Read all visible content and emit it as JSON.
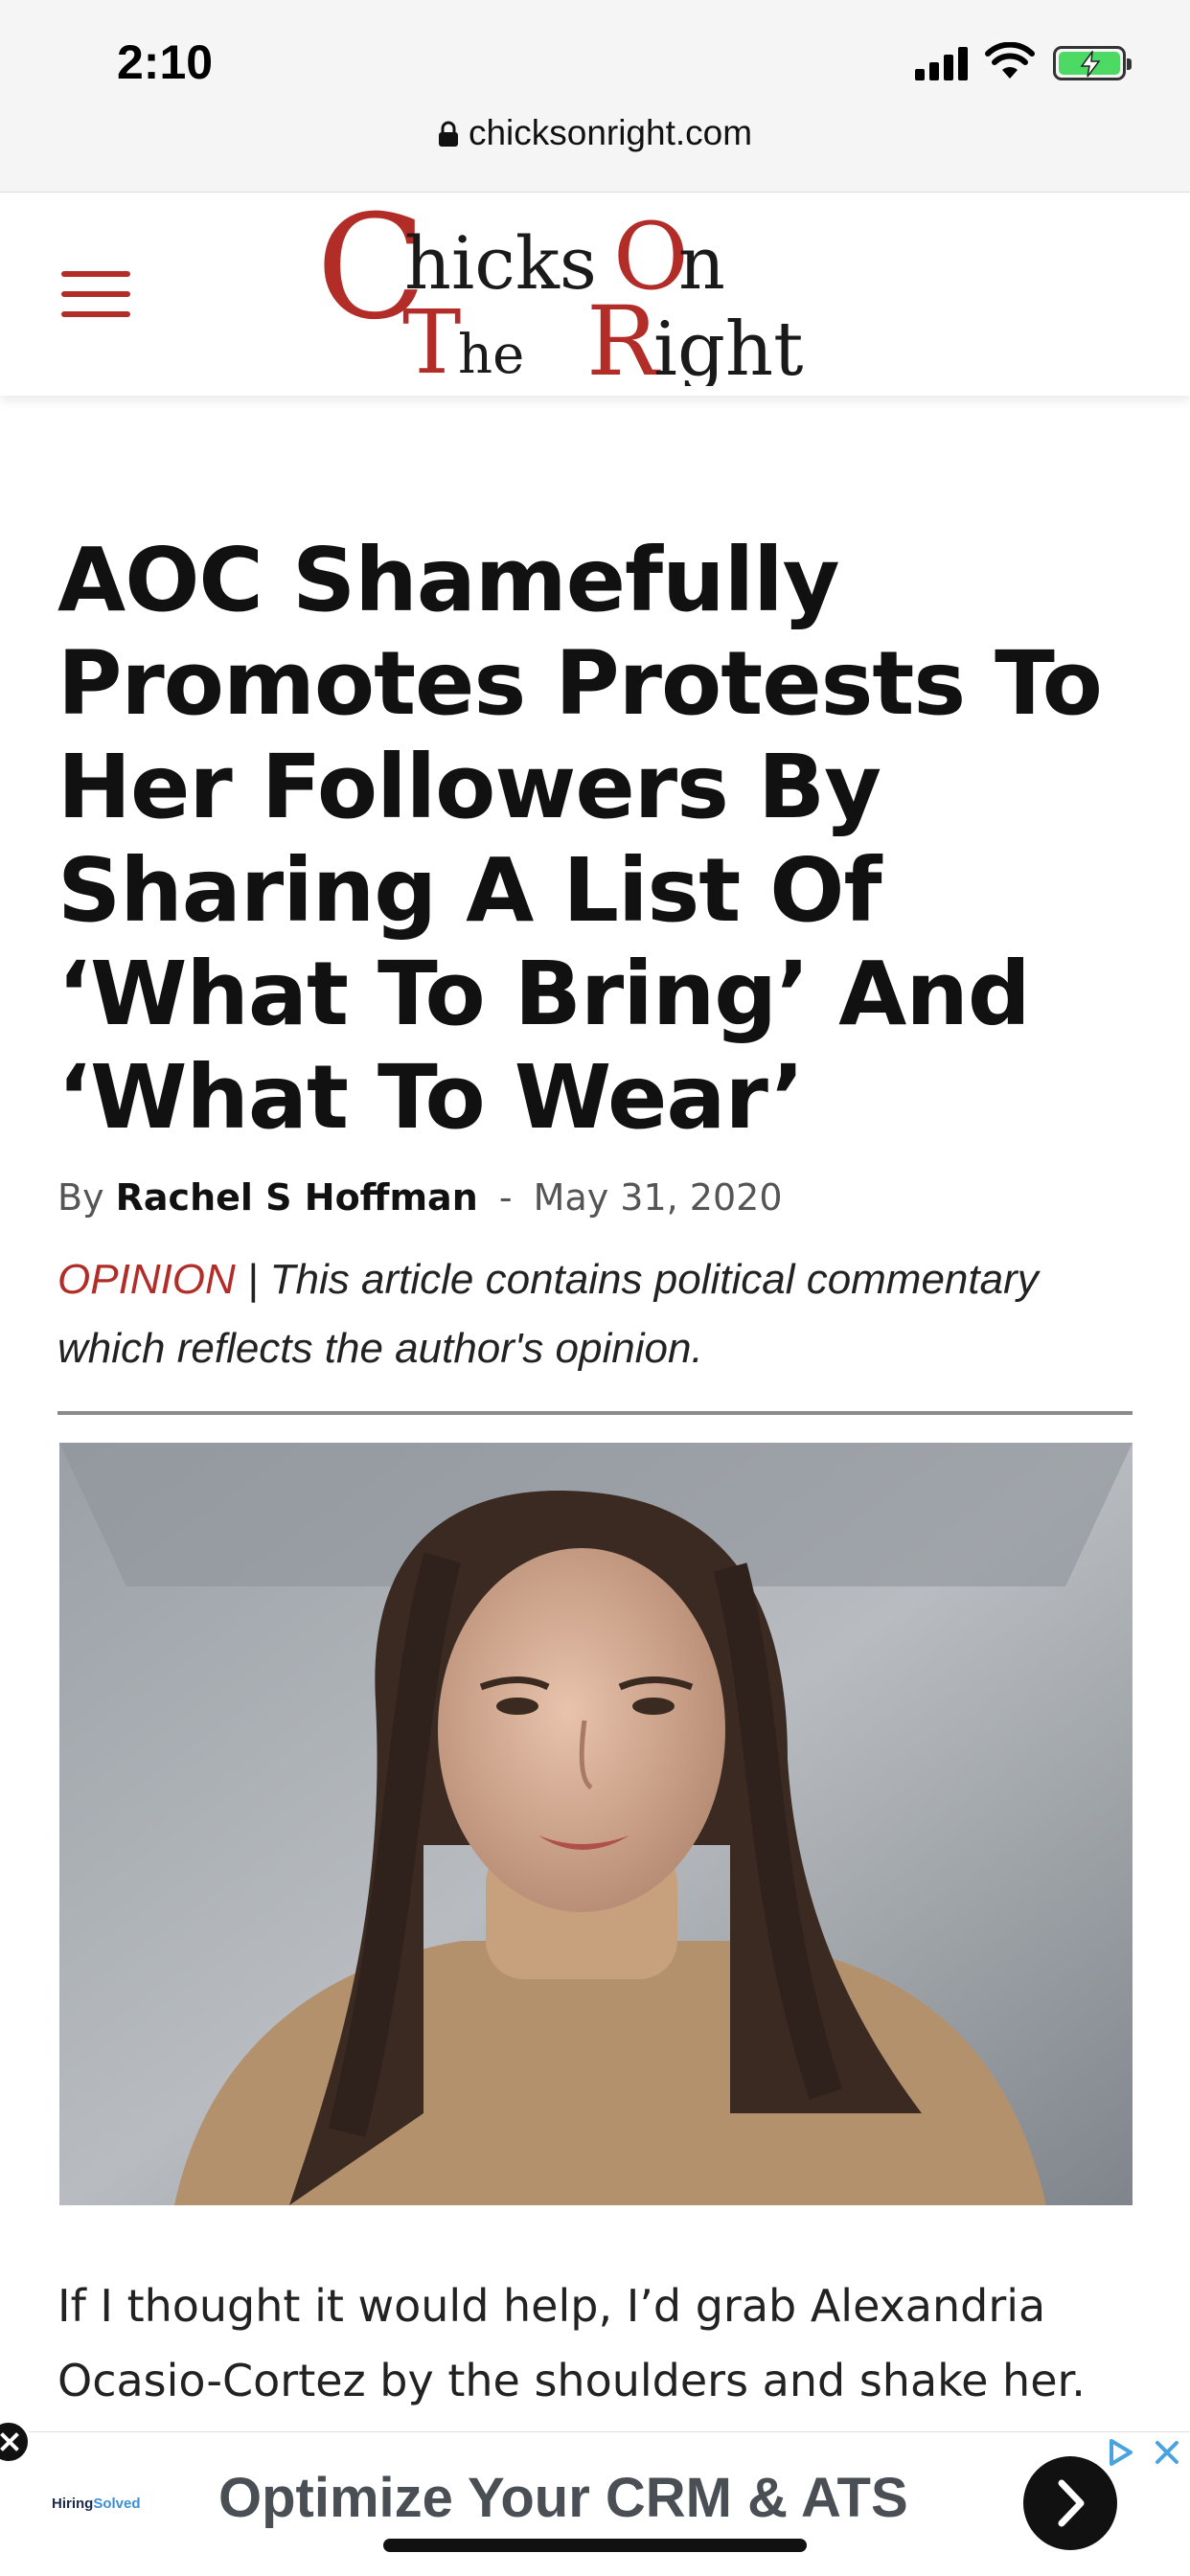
{
  "status_bar": {
    "time": "2:10",
    "icons": [
      "cellular-signal-icon",
      "wifi-icon",
      "battery-charging-icon"
    ],
    "battery_color": "#4cd964"
  },
  "browser": {
    "url": "chicksonright.com",
    "lock_icon": "lock-icon"
  },
  "header": {
    "menu_icon": "hamburger-menu-icon",
    "logo_text": "Chicks On The Right",
    "brand_color": "#b22c28"
  },
  "article": {
    "title": "AOC Shamefully Promotes Protests To Her Followers By Sharing A List Of ‘What To Bring’ And ‘What To Wear’",
    "byline_prefix": "By",
    "author": "Rachel S Hoffman",
    "separator": "-",
    "date": "May 31, 2020",
    "opinion_tag": "OPINION",
    "opinion_text": " | This article contains political commentary which reflects the author's opinion.",
    "body_first_paragraph": "If I thought it would help, I’d grab Alexandria Ocasio-Cortez by the shoulders and shake her."
  },
  "ad": {
    "brand_prefix": "Hiring",
    "brand_suffix": "Solved",
    "headline": "Optimize Your CRM & ATS",
    "icons": [
      "ad-close-icon",
      "adchoices-icon",
      "ad-dismiss-icon",
      "chevron-right-icon"
    ]
  }
}
